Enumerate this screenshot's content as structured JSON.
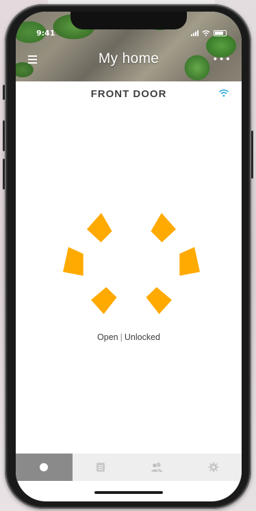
{
  "status_bar": {
    "time": "9:41"
  },
  "header": {
    "title": "My home",
    "menu_icon": "hamburger-menu-icon",
    "more_icon": "more-dots-icon"
  },
  "lock": {
    "name": "FRONT DOOR",
    "connection_icon": "wifi-icon",
    "door_state": "Open",
    "separator": "|",
    "lock_state": "Unlocked",
    "accent_color": "#ffaa00"
  },
  "tabs": [
    {
      "name": "lock",
      "icon": "lock-circle-icon",
      "active": true
    },
    {
      "name": "history",
      "icon": "list-icon",
      "active": false
    },
    {
      "name": "users",
      "icon": "users-icon",
      "active": false
    },
    {
      "name": "settings",
      "icon": "gear-icon",
      "active": false
    }
  ]
}
